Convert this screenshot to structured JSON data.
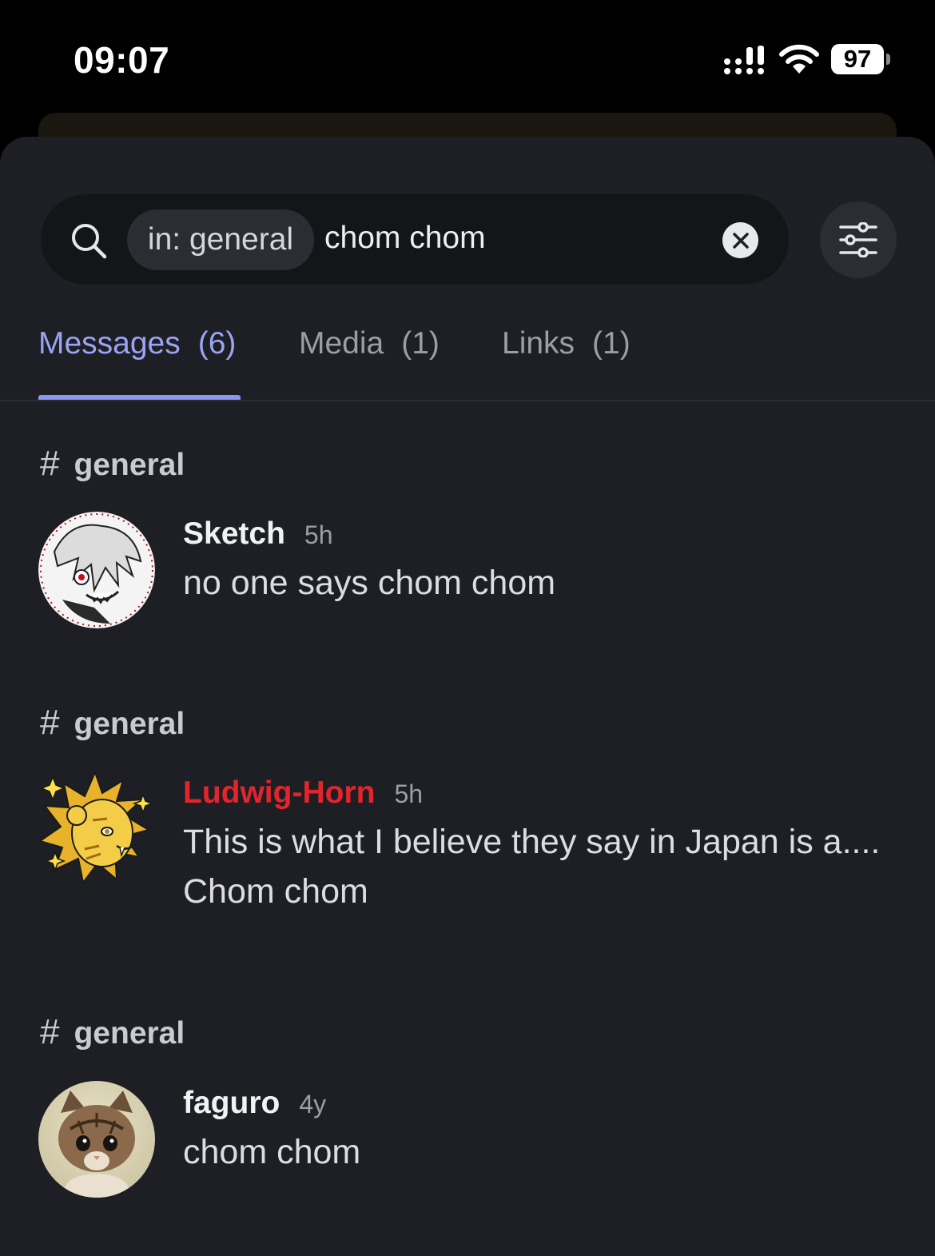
{
  "status_bar": {
    "time": "09:07",
    "battery": "97"
  },
  "search": {
    "filter_chip": "in: general",
    "query": "chom chom"
  },
  "tabs": [
    {
      "label": "Messages",
      "count": "(6)",
      "active": true
    },
    {
      "label": "Media",
      "count": "(1)",
      "active": false
    },
    {
      "label": "Links",
      "count": "(1)",
      "active": false
    }
  ],
  "results": [
    {
      "channel": "general",
      "author": "Sketch",
      "author_color": "#f1f2f4",
      "time": "5h",
      "text": "no one says chom chom",
      "avatar_icon": "anime-character-avatar"
    },
    {
      "channel": "general",
      "author": "Ludwig-Horn",
      "author_color": "#e0262c",
      "time": "5h",
      "text": "This is what I believe they say in Japan is a.... Chom chom",
      "avatar_icon": "lion-character-avatar"
    },
    {
      "channel": "general",
      "author": "faguro",
      "author_color": "#f1f2f4",
      "time": "4y",
      "text": "chom chom",
      "avatar_icon": "kitten-photo-avatar"
    }
  ],
  "colors": {
    "accent": "#8d95f0",
    "background": "#1e1f24",
    "search_background": "#141518"
  }
}
